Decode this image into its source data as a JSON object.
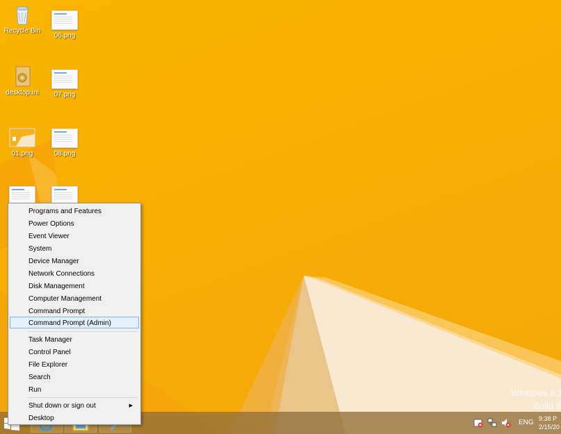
{
  "desktop": {
    "icons": [
      {
        "name": "recycle-bin",
        "label": "Recycle Bin",
        "kind": "recycle"
      },
      {
        "name": "06-png",
        "label": "06.png",
        "kind": "png"
      },
      {
        "name": "desktop-ini",
        "label": "desktop.ini",
        "kind": "ini"
      },
      {
        "name": "07-png",
        "label": "07.png",
        "kind": "png"
      },
      {
        "name": "01-png",
        "label": "01.png",
        "kind": "png"
      },
      {
        "name": "08-png",
        "label": "08.png",
        "kind": "png"
      }
    ],
    "watermark": {
      "line1": "Windows 8.1",
      "line2": "Build 9"
    }
  },
  "winx_menu": {
    "group1": [
      "Programs and Features",
      "Power Options",
      "Event Viewer",
      "System",
      "Device Manager",
      "Network Connections",
      "Disk Management",
      "Computer Management",
      "Command Prompt",
      "Command Prompt (Admin)"
    ],
    "group2": [
      "Task Manager",
      "Control Panel",
      "File Explorer",
      "Search",
      "Run"
    ],
    "group3": [
      "Shut down or sign out",
      "Desktop"
    ],
    "highlighted": "Command Prompt (Admin)",
    "submenu_item": "Shut down or sign out",
    "submenu_arrow": "▶"
  },
  "taskbar": {
    "language": "ENG",
    "time": "9:38 P",
    "date": "2/15/20"
  },
  "colors": {
    "wallpaper": "#f9b400",
    "menu_bg": "#f0f0f0",
    "highlight": "#e5f1fb",
    "highlight_border": "#7eb4ea"
  }
}
